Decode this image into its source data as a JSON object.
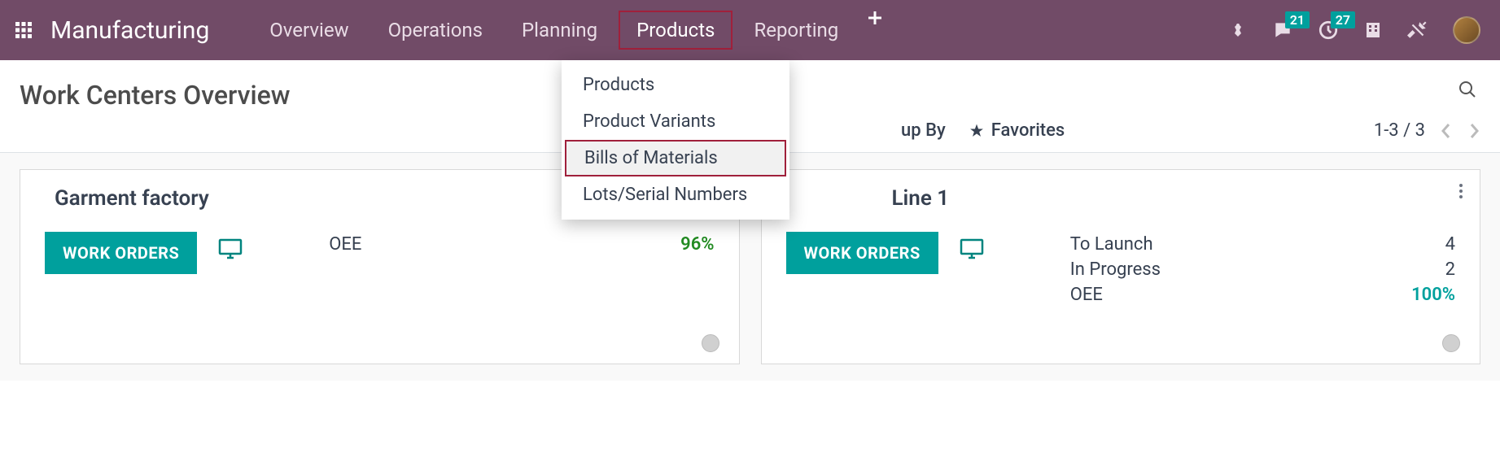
{
  "header": {
    "brand": "Manufacturing",
    "nav": [
      "Overview",
      "Operations",
      "Planning",
      "Products",
      "Reporting"
    ],
    "active_nav_index": 3,
    "messages_badge": "21",
    "activities_badge": "27"
  },
  "page_title": "Work Centers Overview",
  "toolbar": {
    "group_by_label": "up By",
    "favorites_label": "Favorites",
    "pager": "1-3 / 3"
  },
  "dropdown": {
    "items": [
      "Products",
      "Product Variants",
      "Bills of Materials",
      "Lots/Serial Numbers"
    ],
    "highlighted_index": 2
  },
  "cards": [
    {
      "title": "Garment factory",
      "work_orders_label": "WORK ORDERS",
      "stats": [
        {
          "label": "OEE",
          "value": "96%",
          "value_class": "pct-green"
        }
      ],
      "show_kebab": false
    },
    {
      "title": "Line 1",
      "title_prefix_hidden": "Assembly ",
      "work_orders_label": "WORK ORDERS",
      "stats": [
        {
          "label": "To Launch",
          "value": "4",
          "value_class": ""
        },
        {
          "label": "In Progress",
          "value": "2",
          "value_class": ""
        },
        {
          "label": "OEE",
          "value": "100%",
          "value_class": "pct-teal"
        }
      ],
      "show_kebab": true
    }
  ]
}
